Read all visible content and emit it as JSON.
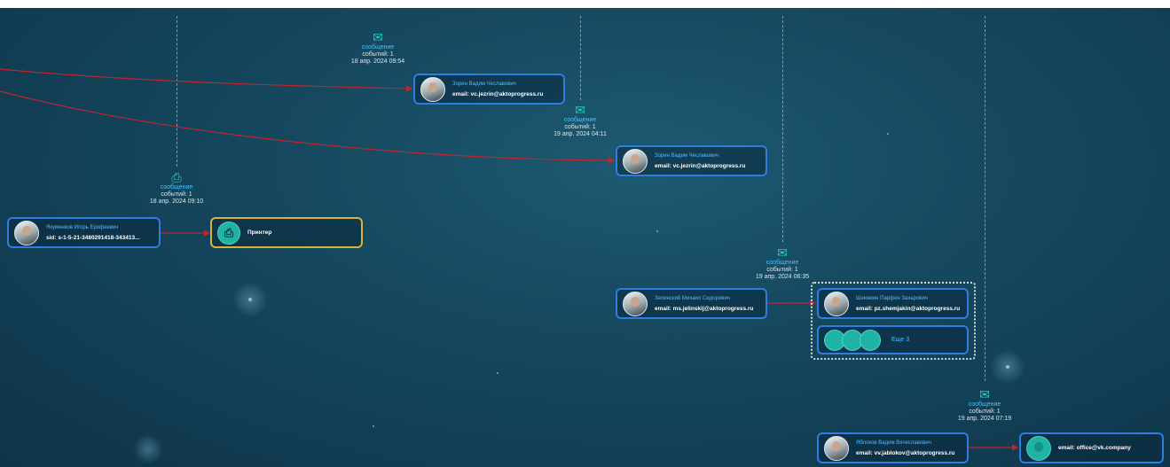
{
  "colors": {
    "background": "#164a61",
    "node_border": "#2f7de0",
    "device_border": "#d9b23a",
    "link": "#c0262c",
    "name_text": "#58b8ff",
    "event_icon": "#22d1c4"
  },
  "events": [
    {
      "icon": "envelope-icon",
      "type": "сообщение",
      "count": "событий: 1",
      "date": "18 апр. 2024 09:54"
    },
    {
      "icon": "envelope-icon",
      "type": "сообщение",
      "count": "событий: 1",
      "date": "19 апр. 2024 04:11"
    },
    {
      "icon": "printer-icon",
      "type": "сообщение",
      "count": "событий: 1",
      "date": "18 апр. 2024 09:10"
    },
    {
      "icon": "envelope-icon",
      "type": "сообщение",
      "count": "событий: 1",
      "date": "19 апр. 2024 06:35"
    },
    {
      "icon": "envelope-reply-icon",
      "type": "сообщение",
      "count": "событий: 1",
      "date": "19 апр. 2024 07:19"
    }
  ],
  "nodes": [
    {
      "name": "Зорин Вадим Чеславович",
      "detail": "email: vc.jezrin@aktoprogress.ru"
    },
    {
      "name": "Зорин Вадим Чеславович",
      "detail": "email: vc.jezrin@aktoprogress.ru"
    },
    {
      "name": "Якуменков Игорь Ерофеевич",
      "detail": "sid: s-1-5-21-3480291418-343413..."
    },
    {
      "name": "",
      "detail": "Принтер"
    },
    {
      "name": "Зелинский Михаил Сидорович",
      "detail": "email: ms.jelinskij@aktoprogress.ru"
    },
    {
      "name": "Шемякин Парфен Захарович",
      "detail": "email: pz.shemjakin@aktoprogress.ru"
    },
    {
      "name": "Яблоков Вадим Вячеславович",
      "detail": "email: vv.jablokov@aktoprogress.ru"
    },
    {
      "name": "",
      "detail": "email: office@vk.company"
    }
  ],
  "more": {
    "label": "Еще 3"
  }
}
